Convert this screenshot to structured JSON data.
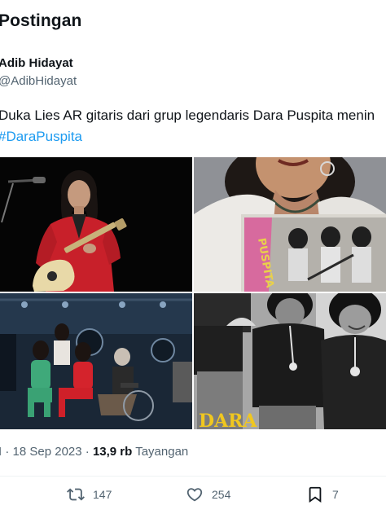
{
  "header": {
    "title": "Postingan"
  },
  "author": {
    "name": "Adib Hidayat",
    "handle": "@AdibHidayat"
  },
  "post": {
    "text": "Duka Lies AR gitaris dari grup legendaris Dara Puspita menin",
    "hashtag": "#DaraPuspita"
  },
  "media": {
    "images": [
      {
        "name": "photo-guitarist-stage"
      },
      {
        "name": "photo-album-cover"
      },
      {
        "name": "photo-group-seated"
      },
      {
        "name": "photo-band-vintage",
        "overlay_text": "DARA"
      }
    ]
  },
  "meta": {
    "time_prefix": "I",
    "date": "18 Sep 2023",
    "separator": "·",
    "views_count": "13,9 rb",
    "views_label": "Tayangan"
  },
  "actions": {
    "retweets": "147",
    "likes": "254",
    "bookmarks": "7"
  },
  "colors": {
    "accent": "#1d9bf0",
    "muted": "#536471",
    "text": "#0f1419"
  }
}
